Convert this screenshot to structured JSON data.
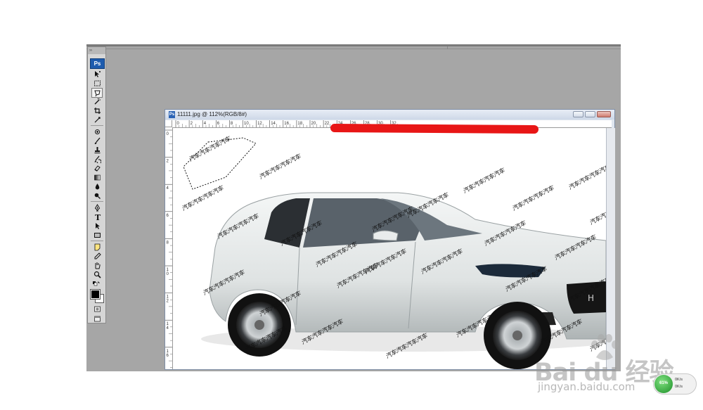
{
  "app": {
    "logo_label": "Ps"
  },
  "toolbox": {
    "grip_label": "››",
    "tools": [
      "move-tool",
      "marquee-tool",
      "lasso-tool",
      "magic-wand-tool",
      "crop-tool",
      "slice-tool",
      "healing-brush-tool",
      "brush-tool",
      "clone-stamp-tool",
      "history-brush-tool",
      "eraser-tool",
      "gradient-tool",
      "blur-tool",
      "dodge-tool",
      "pen-tool",
      "type-tool",
      "path-selection-tool",
      "shape-tool",
      "notes-tool",
      "eyedropper-tool",
      "hand-tool",
      "zoom-tool",
      "default-colors",
      "foreground-background-colors",
      "quick-mask-mode",
      "screen-mode"
    ]
  },
  "document": {
    "title": "11111.jpg @ 112%(RGB/8#)",
    "hruler_numbers": [
      "0",
      "2",
      "4",
      "6",
      "8",
      "10",
      "12",
      "14",
      "16",
      "18",
      "20",
      "22",
      "24",
      "26",
      "28",
      "30",
      "32"
    ],
    "vruler_numbers": [
      "0",
      "2",
      "4",
      "6",
      "8",
      "1\n0",
      "1\n2",
      "1\n4",
      "1\n6"
    ]
  },
  "watermark_text": "汽车汽车汽车汽车",
  "baidu": {
    "brand": "Bai  du 经验",
    "url": "jingyan.baidu.com"
  },
  "netmeter": {
    "percent": "61%",
    "up": "0K/s",
    "down": "0K/s"
  },
  "colors": {
    "workspace": "#a6a6a6",
    "redaction": "#e81616",
    "ps_blue": "#1e5cae"
  }
}
